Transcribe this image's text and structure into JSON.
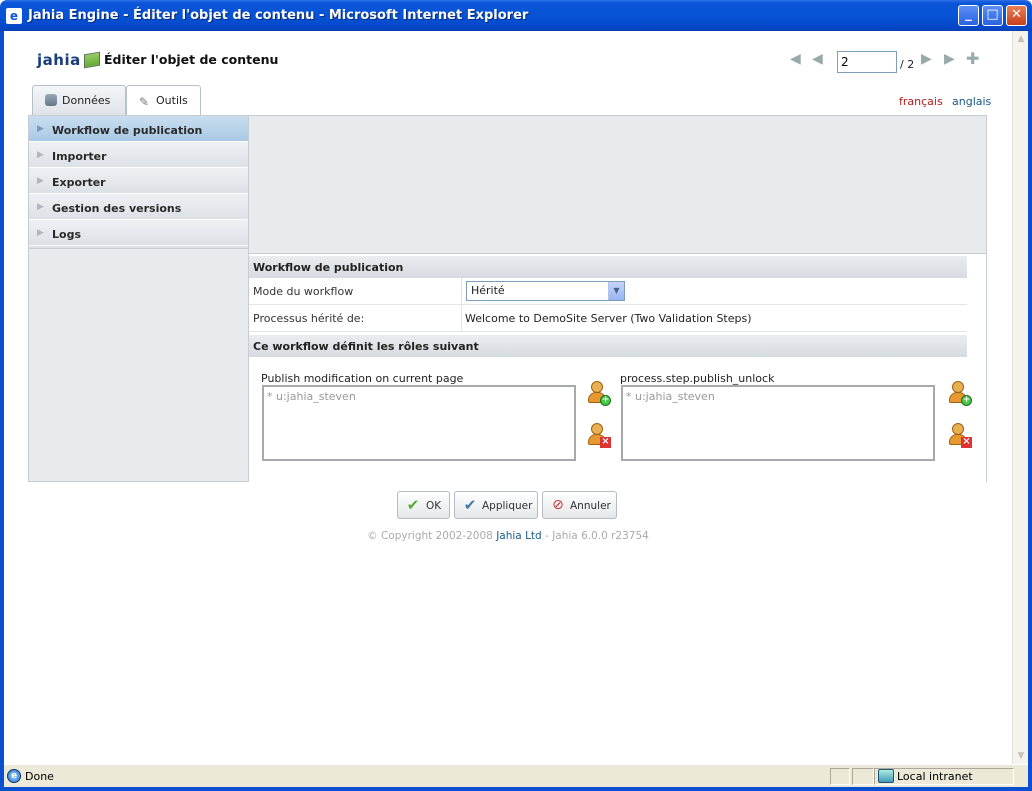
{
  "window": {
    "title": "Jahia Engine - Éditer l'objet de contenu - Microsoft Internet Explorer",
    "minimize": "_",
    "maximize": "□",
    "close": "✕"
  },
  "header": {
    "logo_text": "jahia",
    "page_title": "Éditer l'objet de contenu",
    "pager": {
      "current_page": "2",
      "total": "/ 2"
    }
  },
  "tabs": [
    {
      "label": "Données",
      "active": false,
      "icon": "database-icon"
    },
    {
      "label": "Outils",
      "active": true,
      "icon": "tools-icon"
    }
  ],
  "languages": [
    {
      "label": "français",
      "color": "#b02020"
    },
    {
      "label": "anglais",
      "color": "#1a5a8a"
    }
  ],
  "sidebar": {
    "items": [
      {
        "label": "Workflow de publication",
        "active": true
      },
      {
        "label": "Importer",
        "active": false
      },
      {
        "label": "Exporter",
        "active": false
      },
      {
        "label": "Gestion des versions",
        "active": false
      },
      {
        "label": "Logs",
        "active": false
      }
    ]
  },
  "workflow": {
    "section_title": "Workflow de publication",
    "mode_label": "Mode du workflow",
    "mode_value": "Hérité",
    "inherited_label": "Processus hérité de:",
    "inherited_value": "Welcome to DemoSite Server (Two Validation Steps)",
    "roles_title": "Ce workflow définit les rôles suivant",
    "roles": [
      {
        "label": "Publish modification on current page",
        "members": "*  u:jahia_steven"
      },
      {
        "label": "process.step.publish_unlock",
        "members": "*  u:jahia_steven"
      }
    ]
  },
  "buttons": {
    "ok": "OK",
    "apply": "Appliquer",
    "cancel": "Annuler"
  },
  "footer": {
    "copyright_prefix": "© Copyright 2002-2008",
    "company": "Jahia Ltd",
    "version": "- Jahia 6.0.0 r23754"
  },
  "statusbar": {
    "status": "Done",
    "zone": "Local intranet"
  }
}
